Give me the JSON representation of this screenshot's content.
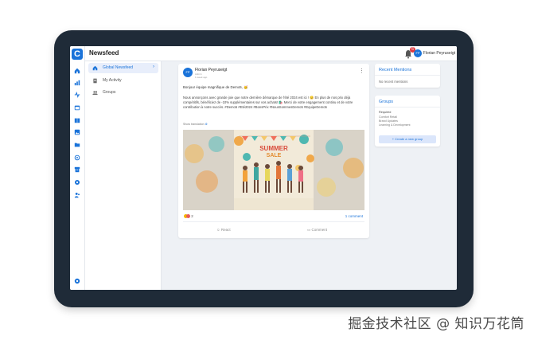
{
  "app": {
    "page_title": "Newsfeed",
    "logo_letter": "C"
  },
  "header": {
    "notification_count": "6",
    "user_initials": "FP",
    "user_name": "Florian Peyruseigt"
  },
  "rail": {
    "icons": [
      "home-icon",
      "chart-icon",
      "activity-icon",
      "calendar-icon",
      "book-icon",
      "image-icon",
      "folder-icon",
      "target-icon",
      "archive-icon",
      "settings-icon",
      "people-icon"
    ],
    "bottom_icon": "help-icon"
  },
  "nav": {
    "items": [
      {
        "label": "Global Newsfeed",
        "icon": "home-icon",
        "active": true
      },
      {
        "label": "My Activity",
        "icon": "document-icon",
        "active": false
      },
      {
        "label": "Groups",
        "icon": "group-icon",
        "active": false
      }
    ]
  },
  "post": {
    "initials": "FP",
    "author": "Florian Peyruseigt",
    "meta_line1": "Admin",
    "meta_line2": "1 week ago",
    "greeting": "Bonjour équipe magnifique de Demo5, 🥳",
    "body": "Nous annonçons avec grande joie que notre dernière démarque de l'été 2024 est ici ! 😊 En plus de nos prix déjà compétitifs, bénéficiez de -10% supplémentaires sur vos achats! 🛍️ Merci de votre engagement continu et de votre contribution à notre succès. #Demo5 #Eté2024 #BonsPrix #NousSommesDemo5 #EquipeDemo5",
    "translate_label": "Show translation",
    "image_text_line1": "SUMMER",
    "image_text_line2": "SALE",
    "reaction_count": "2",
    "comment_count_label": "1 comment",
    "react_label": "React",
    "comment_label": "Comment"
  },
  "recent_mentions": {
    "title": "Recent Mentions",
    "empty_text": "No recent mentions"
  },
  "groups": {
    "title": "Groups",
    "required_label": "Required",
    "items": [
      "Comfort Retail",
      "Brand Updates",
      "Learning & Development"
    ],
    "create_button": "+ Create a new group"
  },
  "watermark": "掘金技术社区 @ 知识万花筒",
  "colors": {
    "accent": "#1a73d9",
    "device_frame": "#1f2b38",
    "screen_bg": "#eef1f5",
    "notification_badge": "#e0383e"
  }
}
